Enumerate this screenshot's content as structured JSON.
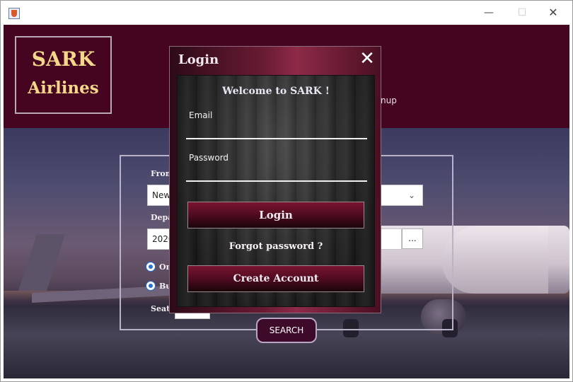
{
  "window": {
    "minimize_glyph": "—",
    "maximize_glyph": "☐",
    "close_glyph": "✕"
  },
  "logo": {
    "line1": "SARK",
    "line2": "Airlines"
  },
  "header": {
    "signup_fragment": "nup"
  },
  "search": {
    "from_label": "From",
    "from_value": "New",
    "departure_label": "Depa",
    "departure_value": "2020",
    "date_button": "...",
    "radio_one_label": "On",
    "radio_business_label": "Bu",
    "seats_label": "Seats",
    "search_button": "SEARCH"
  },
  "login_dialog": {
    "title": "Login",
    "close_glyph": "✕",
    "welcome": "Welcome to SARK !",
    "email_label": "Email",
    "password_label": "Password",
    "login_button": "Login",
    "forgot_link": "Forgot password ?",
    "create_account_button": "Create Account"
  },
  "colors": {
    "header_bg": "#45041f",
    "logo_text": "#f3d78a",
    "button_maroon": "#7a1430"
  }
}
